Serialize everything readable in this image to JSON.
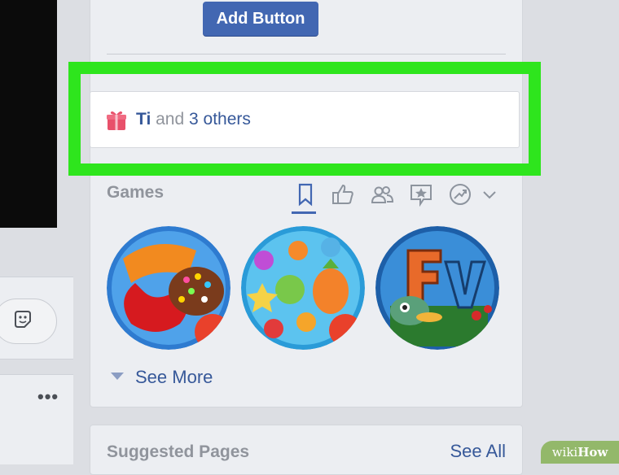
{
  "header": {
    "add_button_label": "Add Button"
  },
  "likes": {
    "name": "Ti",
    "connector": " and ",
    "others": "3 others"
  },
  "games": {
    "title": "Games",
    "see_more": "See More",
    "tabs": [
      "bookmark-icon",
      "thumbs-up-icon",
      "friends-icon",
      "star-speech-icon",
      "trending-icon",
      "chevron-down-icon"
    ],
    "items": [
      "candy-crush-icon",
      "farm-heroes-icon",
      "farmville-icon"
    ]
  },
  "suggested": {
    "title": "Suggested Pages",
    "see_all": "See All"
  },
  "watermark": {
    "wiki": "wiki",
    "how": "How"
  },
  "colors": {
    "accent": "#4267b2",
    "link": "#365899",
    "highlight": "#2ee51d"
  }
}
